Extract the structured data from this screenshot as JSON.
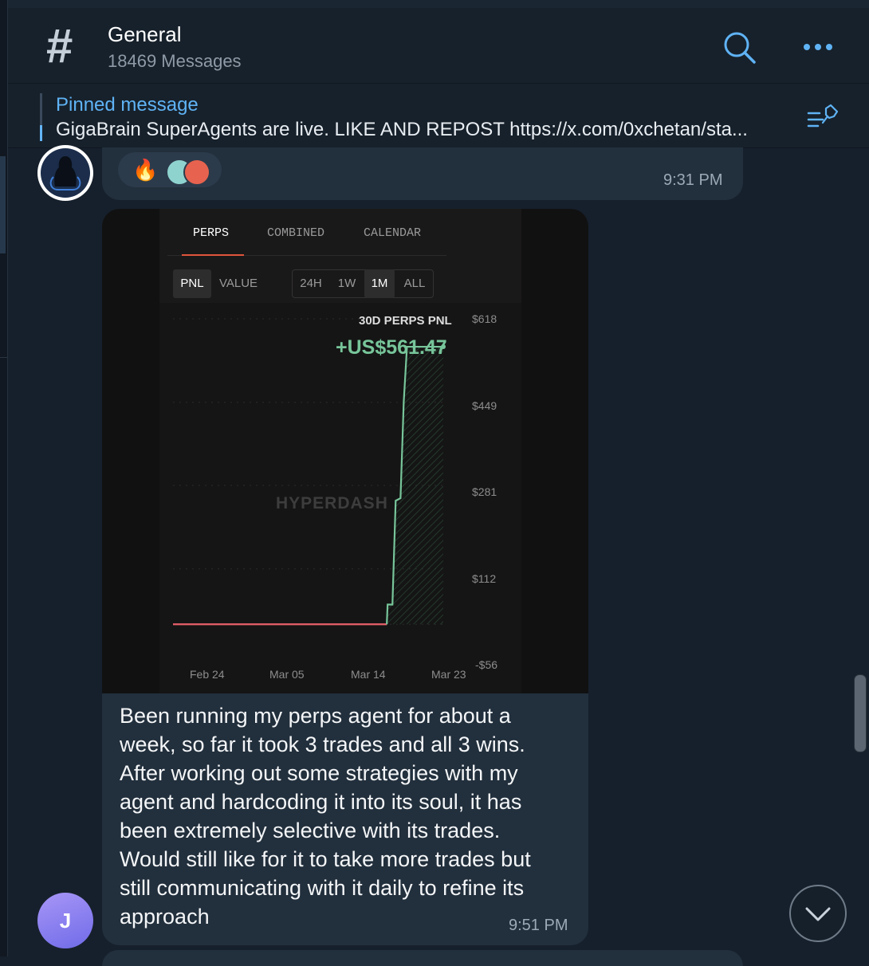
{
  "channel": {
    "title": "General",
    "subtitle": "18469 Messages",
    "hash_symbol": "#"
  },
  "icons": {
    "search": "search-icon",
    "more": "more-icon",
    "pinned_list": "pinned-list-icon",
    "scroll_down": "chevron-down-icon"
  },
  "pinned": {
    "label": "Pinned message",
    "text": "GigaBrain SuperAgents are live.  LIKE AND REPOST https://x.com/0xchetan/sta..."
  },
  "messages": [
    {
      "reactions": [
        "🔥"
      ],
      "time": "9:31 PM"
    },
    {
      "avatar_initial": "J",
      "text": "Been running my perps agent for about a week, so far it took 3 trades and all 3 wins. After working out some strategies with my agent and hardcoding it into its soul, it has been extremely selective with its trades. Would still like for it to take more trades but still communicating with it daily to refine its approach",
      "time": "9:51 PM"
    }
  ],
  "screenshot": {
    "tabs": [
      "PERPS",
      "COMBINED",
      "CALENDAR"
    ],
    "active_tab": "PERPS",
    "mode_buttons": [
      "PNL",
      "VALUE"
    ],
    "active_mode": "PNL",
    "range_buttons": [
      "24H",
      "1W",
      "1M",
      "ALL"
    ],
    "active_range": "1M",
    "watermark": "HYPERDASH",
    "colors": {
      "positive": "#77c59a",
      "negative": "#e8606a",
      "tab_accent": "#e0553c"
    }
  },
  "chart_data": {
    "type": "line",
    "title": "30D PERPS PNL",
    "value_label": "+US$561.47",
    "y_ticks": [
      "$618",
      "$449",
      "$281",
      "$112",
      "-$56"
    ],
    "x_ticks": [
      "Feb 24",
      "Mar 05",
      "Mar 14",
      "Mar 23"
    ],
    "ylim": [
      -56,
      618
    ],
    "x": [
      0,
      26.5,
      26.6,
      27.2,
      27.6,
      28.2,
      28.6,
      29.0,
      33.5
    ],
    "values": [
      0,
      0,
      40,
      40,
      250,
      255,
      450,
      561.47,
      561.47
    ],
    "grid": true
  }
}
